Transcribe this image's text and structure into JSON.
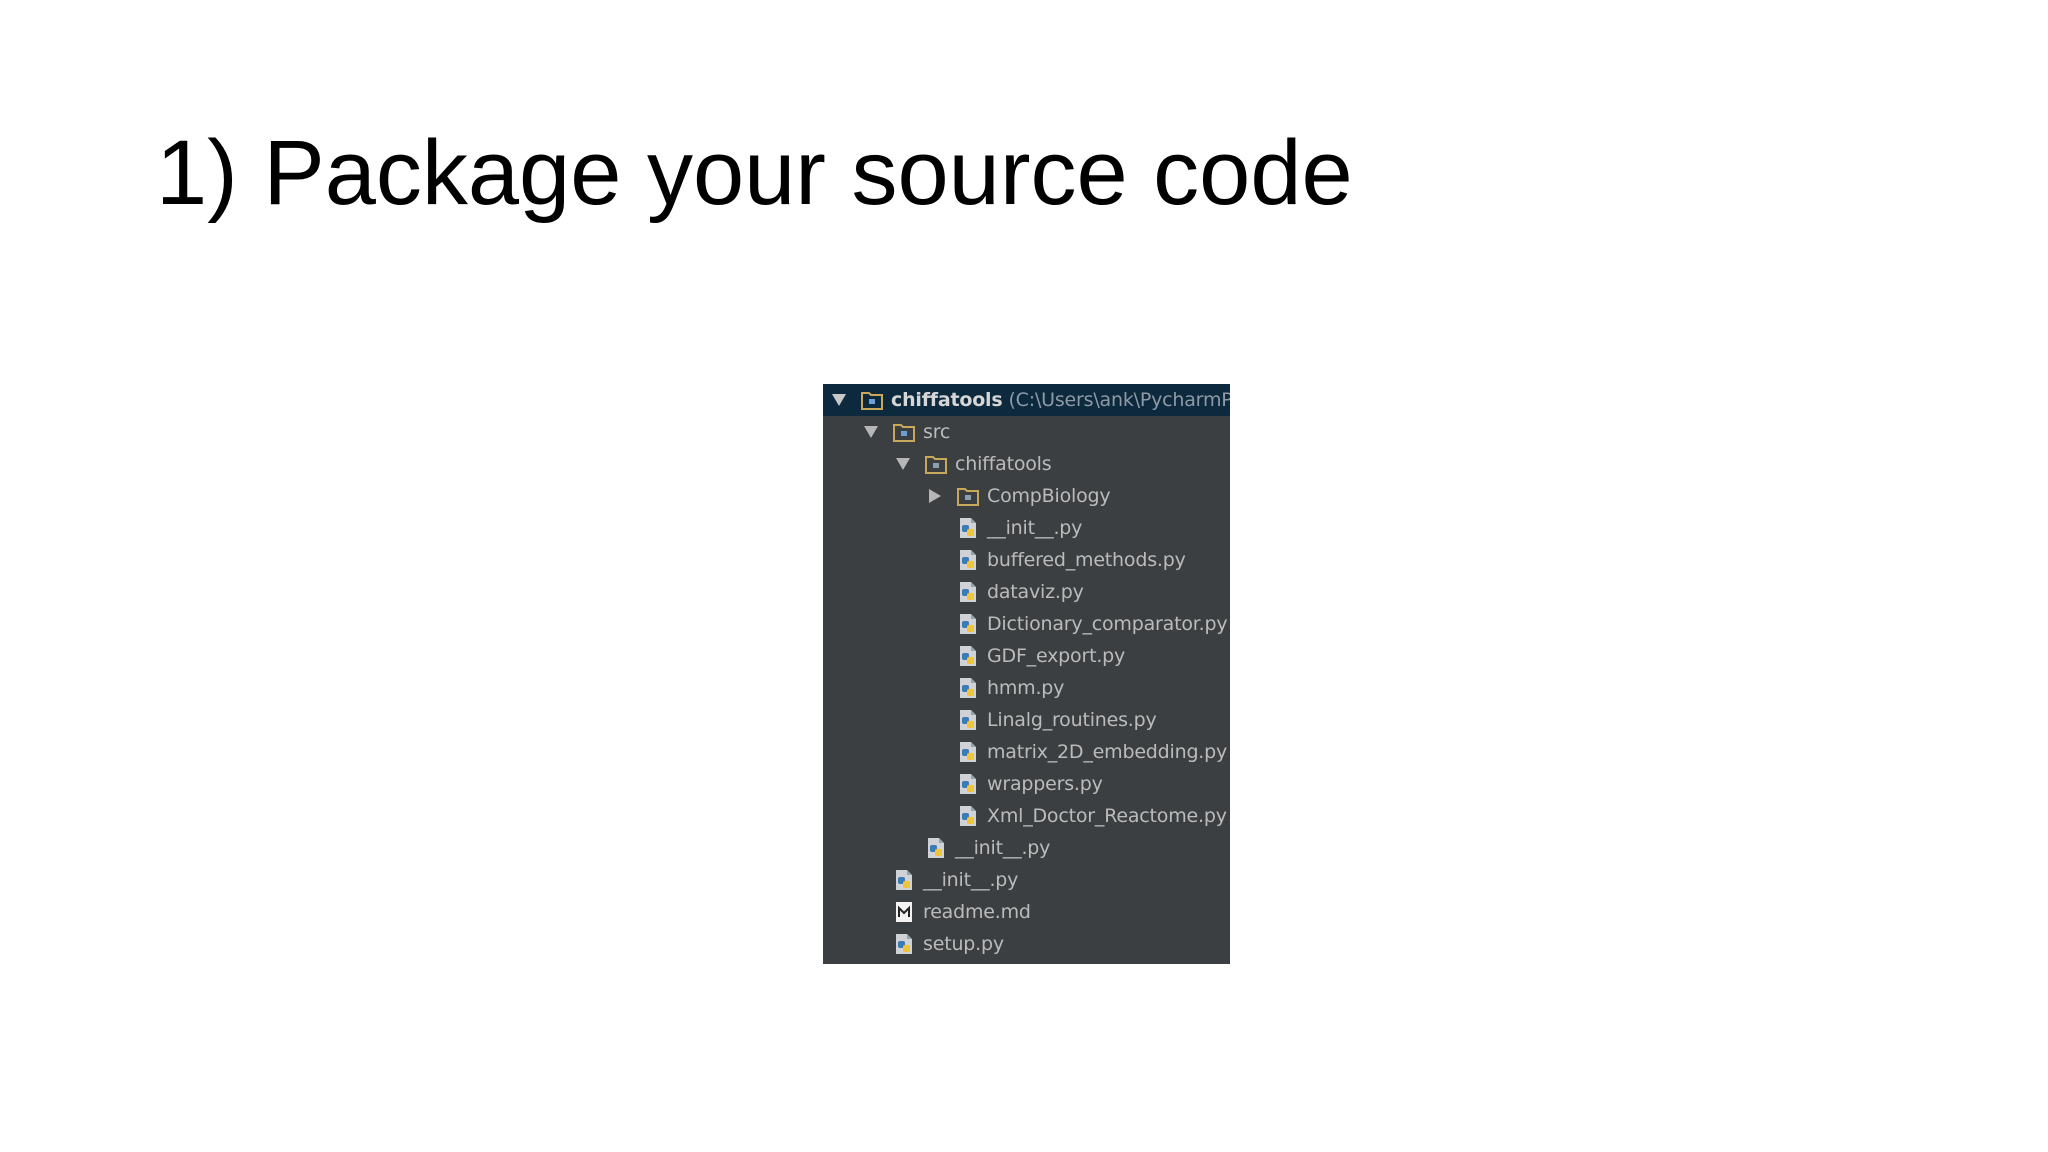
{
  "slide": {
    "title": "1) Package your source code"
  },
  "tree": {
    "root": {
      "label": "chiffatools",
      "path": "(C:\\Users\\ank\\PycharmProje"
    },
    "src": {
      "label": "src"
    },
    "pkg": {
      "label": "chiffatools"
    },
    "compbio": {
      "label": "CompBiology"
    },
    "pkg_files": [
      "__init__.py",
      "buffered_methods.py",
      "dataviz.py",
      "Dictionary_comparator.py",
      "GDF_export.py",
      "hmm.py",
      "Linalg_routines.py",
      "matrix_2D_embedding.py",
      "wrappers.py",
      "Xml_Doctor_Reactome.py"
    ],
    "src_init": "__init__.py",
    "root_files": [
      {
        "label": "__init__.py",
        "icon": "python-file-icon"
      },
      {
        "label": "readme.md",
        "icon": "markdown-file-icon"
      },
      {
        "label": "setup.py",
        "icon": "python-file-icon"
      }
    ]
  }
}
